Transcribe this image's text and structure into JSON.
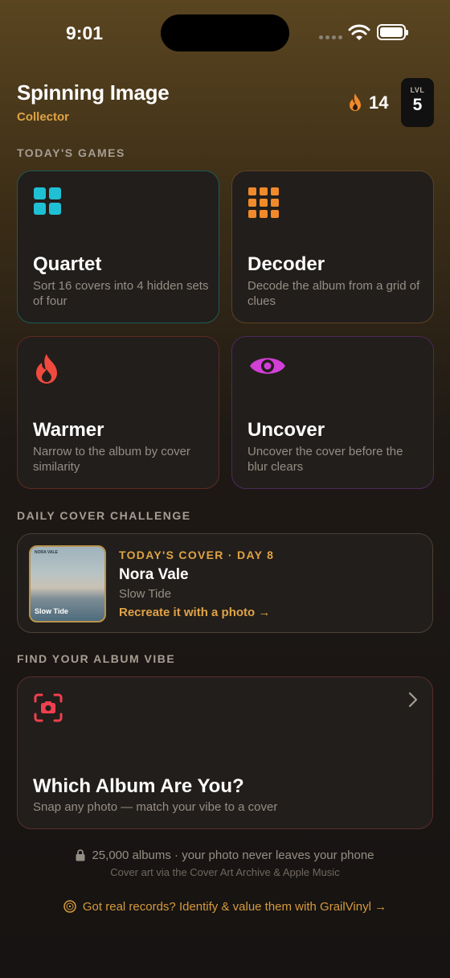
{
  "status_bar": {
    "time": "9:01"
  },
  "header": {
    "title": "Spinning Image",
    "subtitle": "Collector",
    "streak_icon": "flame-icon",
    "streak_count": "14",
    "level_label": "LVL",
    "level_value": "5"
  },
  "sections": {
    "games": "TODAY'S GAMES",
    "challenge": "DAILY COVER CHALLENGE",
    "vibe": "FIND YOUR ALBUM VIBE"
  },
  "games": [
    {
      "title": "Quartet",
      "description": "Sort 16 covers into 4 hidden sets of four",
      "icon": "grid-2x2-icon",
      "color": "#1fc0d4",
      "border": "#1f5a55"
    },
    {
      "title": "Decoder",
      "description": "Decode the album from a grid of clues",
      "icon": "grid-3x3-icon",
      "color": "#f08a2a",
      "border": "#5d4225"
    },
    {
      "title": "Warmer",
      "description": "Narrow to the album by cover similarity",
      "icon": "flame-icon",
      "color": "#f04a3e",
      "border": "#5e2a22"
    },
    {
      "title": "Uncover",
      "description": "Uncover the cover before the blur clears",
      "icon": "eye-icon",
      "color": "#d13fd6",
      "border": "#4d2a5a"
    }
  ],
  "challenge": {
    "kicker": "TODAY'S COVER · DAY 8",
    "artist": "Nora Vale",
    "album": "Slow Tide",
    "cta": "Recreate it with a photo →",
    "cover_small_text": "NORA VALE",
    "cover_label": "Slow Tide"
  },
  "vibe": {
    "icon": "camera-scan-icon",
    "title": "Which Album Are You?",
    "description": "Snap any photo — match your vibe to a cover"
  },
  "footer": {
    "line1": "25,000 albums · your photo never leaves your phone",
    "line2": "Cover art via the Cover Art Archive & Apple Music",
    "promo": "Got real records? Identify & value them with GrailVinyl →"
  }
}
